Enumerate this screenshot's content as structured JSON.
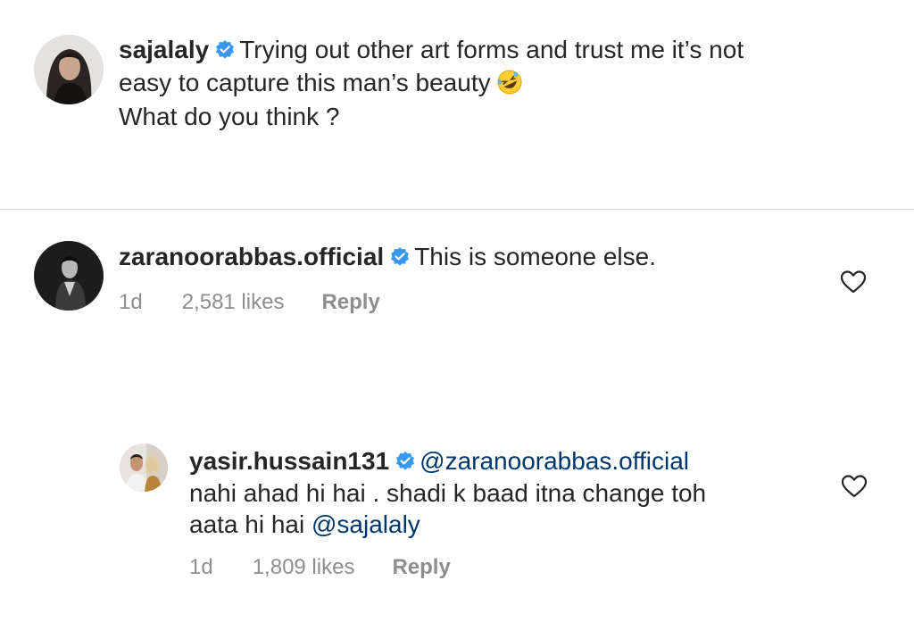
{
  "caption": {
    "username": "sajalaly",
    "text_line1": "Trying out other art forms and trust me it’s not",
    "text_line2": "easy to capture this man’s beauty",
    "text_line3": "What do you think ?",
    "emoji": "rolling-on-floor-laughing-emoji"
  },
  "comments": [
    {
      "username": "zaranoorabbas.official",
      "text": "This is someone else.",
      "time": "1d",
      "likes": "2,581 likes",
      "reply_label": "Reply"
    }
  ],
  "replies": [
    {
      "username": "yasir.hussain131",
      "mention_line1": "@zaranoorabbas.official",
      "text_line2": "nahi ahad hi hai . shadi k baad itna change toh",
      "text_line3_prefix": "aata hi hai ",
      "mention_line3": "@sajalaly",
      "time": "1d",
      "likes": "1,809 likes",
      "reply_label": "Reply"
    }
  ],
  "colors": {
    "text": "#262626",
    "meta": "#8e8e8e",
    "mention": "#00376b",
    "verified": "#3897f0"
  }
}
